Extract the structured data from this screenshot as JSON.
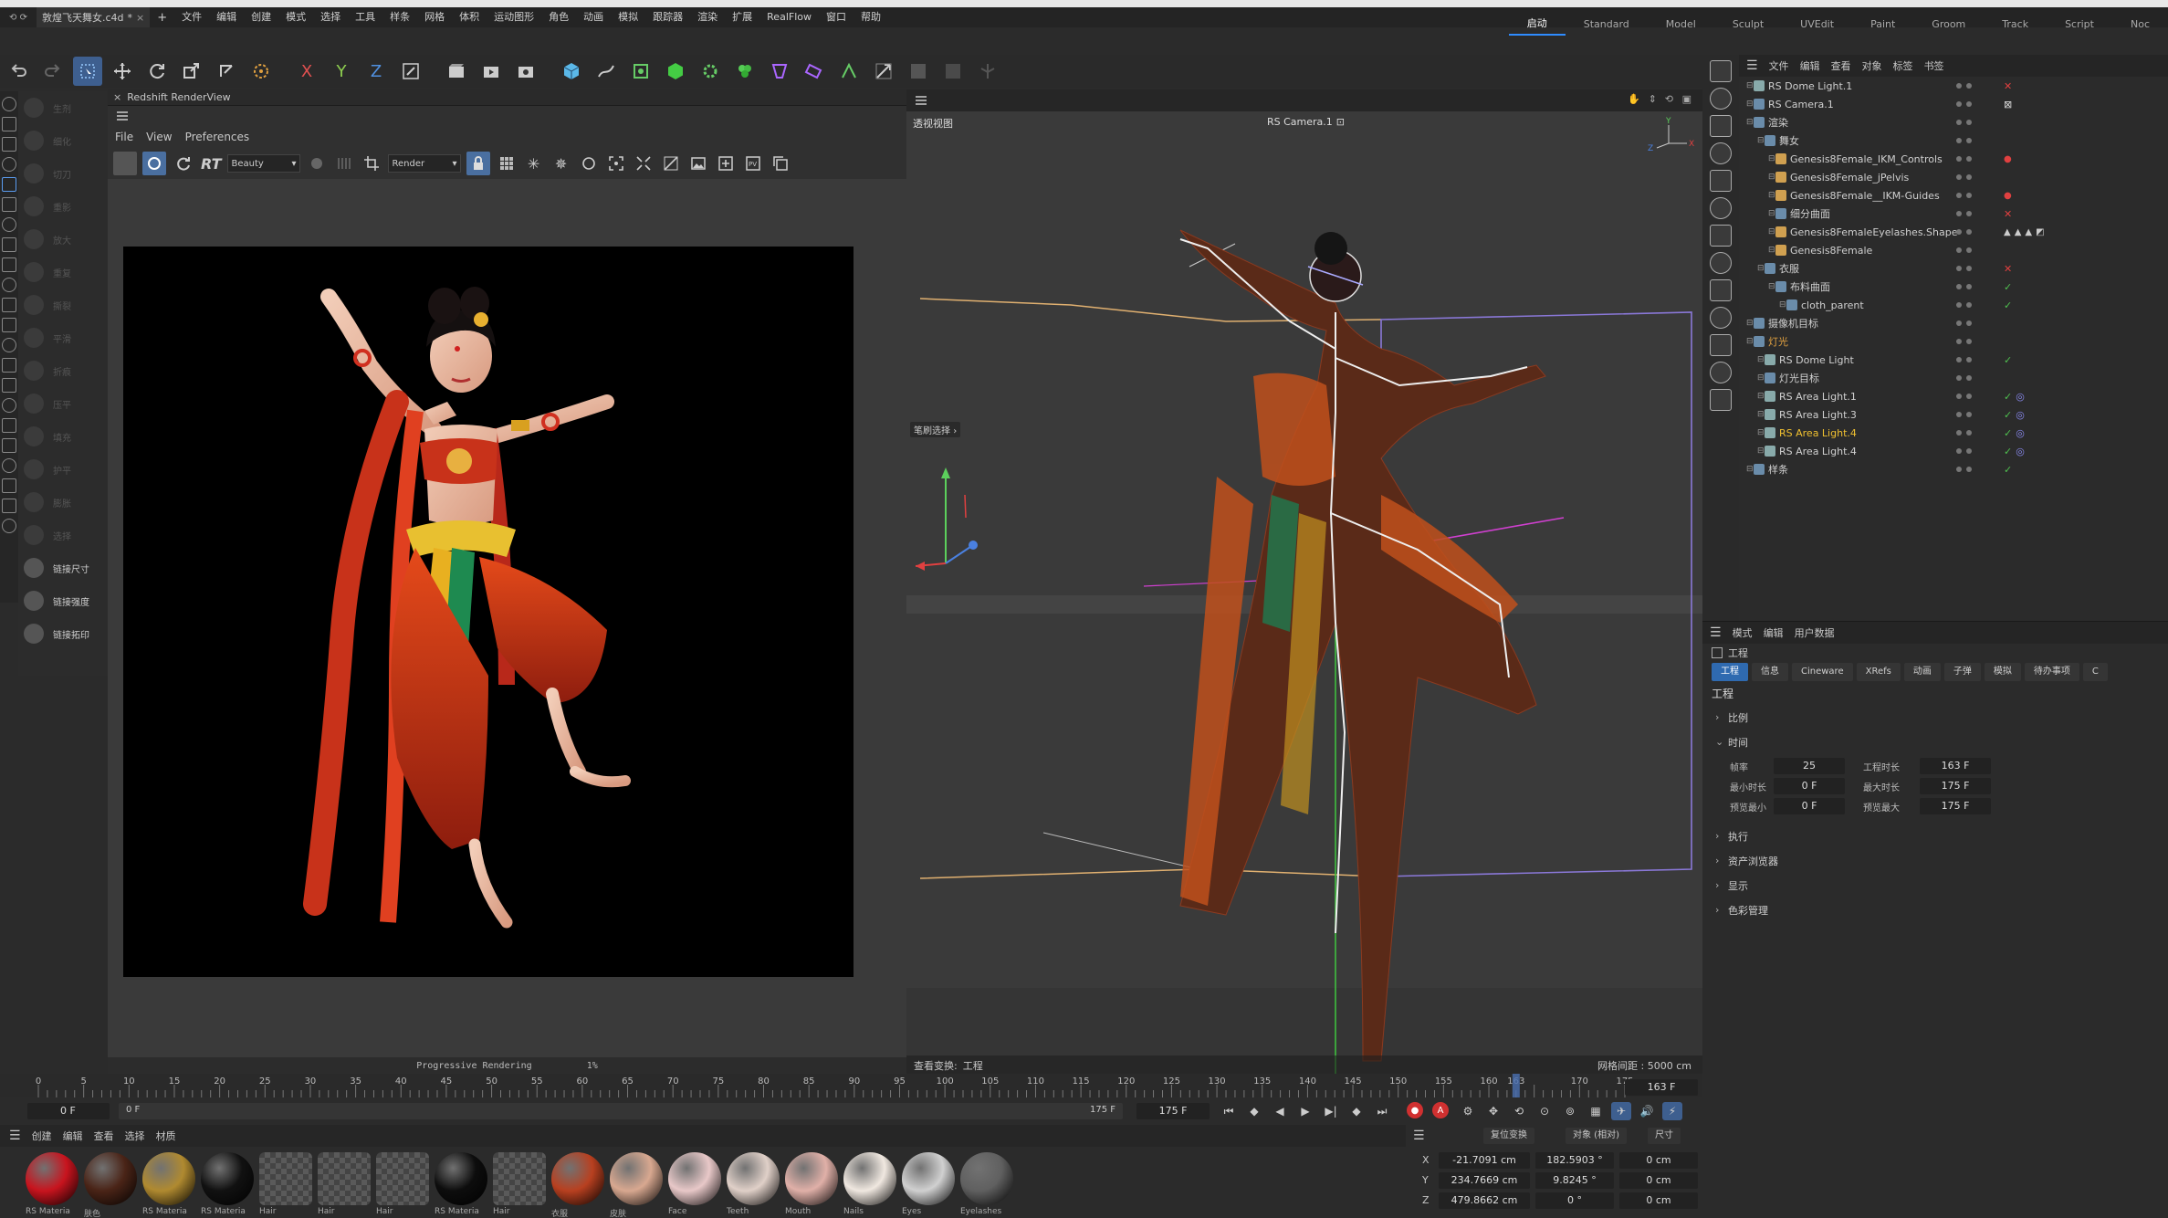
{
  "titlebar": {
    "left": "⟲ ⟳",
    "text": "敦煌飞天舞女.c4d",
    "modified": "*",
    "close": "×",
    "add": "+"
  },
  "menu": {
    "items": [
      "文件",
      "编辑",
      "创建",
      "模式",
      "选择",
      "工具",
      "样条",
      "网格",
      "体积",
      "运动图形",
      "角色",
      "动画",
      "模拟",
      "跟踪器",
      "渲染",
      "扩展",
      "RealFlow",
      "窗口",
      "帮助"
    ]
  },
  "layouts": {
    "items": [
      "启动",
      "Standard",
      "Model",
      "Sculpt",
      "UVEdit",
      "Paint",
      "Groom",
      "Track",
      "Script",
      "Noc"
    ],
    "active": "启动"
  },
  "palette": {
    "items": [
      "生剂",
      "细化",
      "切刀",
      "重影",
      "放大",
      "重复",
      "撕裂",
      "平滑",
      "折痕",
      "压平",
      "填充",
      "护平",
      "膨胀",
      "选择"
    ],
    "links": [
      "链接尺寸",
      "链接强度",
      "链接拓印"
    ]
  },
  "render_view": {
    "title": "Redshift RenderView",
    "menus": [
      "File",
      "View",
      "Preferences"
    ],
    "rt_label": "RT",
    "aov": "Beauty",
    "render_dropdown": "Render",
    "status": "Progressive Rendering",
    "percent": "1%"
  },
  "viewport": {
    "name": "透视视图",
    "camera": "RS Camera.1",
    "brush_label": "笔刷选择",
    "view_transform_label": "查看变换:",
    "view_transform_value": "工程",
    "grid_spacing": "网格间距 : 5000 cm"
  },
  "object_manager": {
    "menus": [
      "文件",
      "编辑",
      "查看",
      "对象",
      "标签",
      "书签"
    ],
    "rows": [
      {
        "name": "RS Dome Light.1",
        "depth": 0,
        "color": "#d0d0d0",
        "status": "x"
      },
      {
        "name": "RS Camera.1",
        "depth": 0,
        "color": "#d0d0d0",
        "status": "tgt"
      },
      {
        "name": "渲染",
        "depth": 0,
        "color": "#d0d0d0",
        "status": ""
      },
      {
        "name": "舞女",
        "depth": 1,
        "color": "#d0d0d0",
        "status": ""
      },
      {
        "name": "Genesis8Female_IKM_Controls",
        "depth": 2,
        "color": "#d0d0d0",
        "status": "dot"
      },
      {
        "name": "Genesis8Female_jPelvis",
        "depth": 2,
        "color": "#d0d0d0",
        "status": ""
      },
      {
        "name": "Genesis8Female__IKM-Guides",
        "depth": 2,
        "color": "#d0d0d0",
        "status": "dot"
      },
      {
        "name": "细分曲面",
        "depth": 2,
        "color": "#d0d0d0",
        "status": "x"
      },
      {
        "name": "Genesis8FemaleEyelashes.Shape",
        "depth": 2,
        "color": "#d0d0d0",
        "status": "tags"
      },
      {
        "name": "Genesis8Female",
        "depth": 2,
        "color": "#d0d0d0",
        "status": ""
      },
      {
        "name": "衣服",
        "depth": 1,
        "color": "#d0d0d0",
        "status": "x"
      },
      {
        "name": "布料曲面",
        "depth": 2,
        "color": "#d0d0d0",
        "status": "check"
      },
      {
        "name": "cloth_parent",
        "depth": 3,
        "color": "#d0d0d0",
        "status": "check"
      },
      {
        "name": "摄像机目标",
        "depth": 0,
        "color": "#d0d0d0",
        "status": ""
      },
      {
        "name": "灯光",
        "depth": 0,
        "color": "#e0a040",
        "status": ""
      },
      {
        "name": "RS Dome Light",
        "depth": 1,
        "color": "#d0d0d0",
        "status": "check"
      },
      {
        "name": "灯光目标",
        "depth": 1,
        "color": "#d0d0d0",
        "status": ""
      },
      {
        "name": "RS Area Light.1",
        "depth": 1,
        "color": "#d0d0d0",
        "status": "check"
      },
      {
        "name": "RS Area Light.3",
        "depth": 1,
        "color": "#d0d0d0",
        "status": "check"
      },
      {
        "name": "RS Area Light.4",
        "depth": 1,
        "color": "#f0c030",
        "status": "check"
      },
      {
        "name": "RS Area Light.4",
        "depth": 1,
        "color": "#d0d0d0",
        "status": "check"
      },
      {
        "name": "样条",
        "depth": 0,
        "color": "#d0d0d0",
        "status": "check"
      }
    ]
  },
  "attributes": {
    "menus": [
      "模式",
      "编辑",
      "用户数据"
    ],
    "object": "工程",
    "tabs": [
      "工程",
      "信息",
      "Cineware",
      "XRefs",
      "动画",
      "子弹",
      "模拟",
      "待办事项",
      "C"
    ],
    "active_tab": "工程",
    "section_title": "工程",
    "groups": [
      "比例",
      "时间",
      "执行",
      "资产浏览器",
      "显示",
      "色彩管理"
    ],
    "time": {
      "fps_label": "帧率",
      "fps": "25",
      "doc_len_label": "工程时长",
      "doc_len": "163 F",
      "min_label": "最小时长",
      "min": "0 F",
      "max_label": "最大时长",
      "max": "175 F",
      "pmin_label": "预览最小",
      "pmin": "0 F",
      "pmax_label": "预览最大",
      "pmax": "175 F"
    }
  },
  "timeline": {
    "ticks": [
      "0",
      "5",
      "10",
      "15",
      "20",
      "25",
      "30",
      "35",
      "40",
      "45",
      "50",
      "55",
      "60",
      "65",
      "70",
      "75",
      "80",
      "85",
      "90",
      "95",
      "100",
      "105",
      "110",
      "115",
      "120",
      "125",
      "130",
      "135",
      "140",
      "145",
      "150",
      "155",
      "160",
      "163",
      "170",
      "175"
    ],
    "current": "163 F",
    "playhead": 163,
    "max": 175,
    "start": "0 F",
    "start2": "0 F",
    "end": "175 F",
    "end2": "175 F"
  },
  "materials": {
    "menus": [
      "创建",
      "编辑",
      "查看",
      "选择",
      "材质"
    ],
    "items": [
      {
        "label": "RS Materia",
        "color": "#c8141e"
      },
      {
        "label": "肤色",
        "color": "#4a2417"
      },
      {
        "label": "RS Materia",
        "color": "#b08a30"
      },
      {
        "label": "RS Materia",
        "color": "#111111"
      },
      {
        "label": "Hair",
        "color": "#555555"
      },
      {
        "label": "Hair",
        "color": "#5a5a5a"
      },
      {
        "label": "Hair",
        "color": "#505050"
      },
      {
        "label": "RS Materia",
        "color": "#0d0d0d"
      },
      {
        "label": "Hair",
        "color": "#777777"
      },
      {
        "label": "衣服",
        "color": "#b84020"
      },
      {
        "label": "皮肤",
        "color": "#d8a890"
      },
      {
        "label": "Face",
        "color": "#e8c8c8"
      },
      {
        "label": "Teeth",
        "color": "#e0d0c8"
      },
      {
        "label": "Mouth",
        "color": "#e0b0a8"
      },
      {
        "label": "Nails",
        "color": "#f0e8e0"
      },
      {
        "label": "Eyes",
        "color": "#d0d0d0"
      },
      {
        "label": "Eyelashes",
        "color": "#606060"
      }
    ]
  },
  "coords": {
    "mode1": "复位变换",
    "mode2": "对象 (相对)",
    "mode3": "尺寸",
    "axes": [
      "X",
      "Y",
      "Z"
    ],
    "pos": [
      "-21.7091 cm",
      "234.7669 cm",
      "479.8662 cm"
    ],
    "rot": [
      "182.5903 °",
      "9.8245 °",
      "0 °"
    ],
    "size": [
      "0 cm",
      "0 cm",
      "0 cm"
    ]
  },
  "colors": {
    "accent": "#2f8cff",
    "orange": "#e0a040",
    "red": "#e04040",
    "green": "#4fc04f"
  }
}
